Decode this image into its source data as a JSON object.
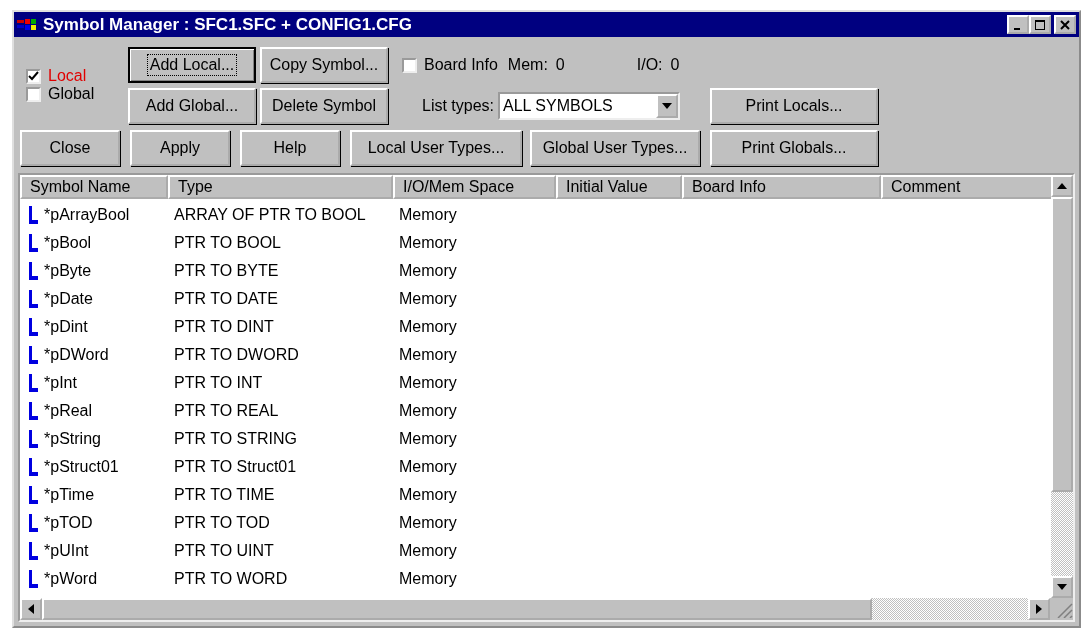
{
  "window": {
    "title": "Symbol Manager : SFC1.SFC + CONFIG1.CFG"
  },
  "scope_checkboxes": [
    {
      "label": "Local",
      "checked": true
    },
    {
      "label": "Global",
      "checked": false
    }
  ],
  "row1_buttons": [
    {
      "label": "Add Local...",
      "focused": true
    },
    {
      "label": "Copy Symbol...",
      "focused": false
    }
  ],
  "board_info": {
    "label": "Board Info",
    "checked": false
  },
  "mem": {
    "label": "Mem:",
    "value": "0"
  },
  "io": {
    "label": "I/O:",
    "value": "0"
  },
  "row2_buttons": [
    {
      "label": "Add Global...",
      "focused": false
    },
    {
      "label": "Delete Symbol",
      "focused": false
    }
  ],
  "list_types": {
    "label": "List types:",
    "value": "ALL SYMBOLS"
  },
  "print_locals": {
    "label": "Print Locals..."
  },
  "row3_buttons": [
    "Close",
    "Apply",
    "Help",
    "Local User Types...",
    "Global User Types...",
    "Print Globals..."
  ],
  "table": {
    "columns": [
      "Symbol Name",
      "Type",
      "I/O/Mem Space",
      "Initial Value",
      "Board Info",
      "Comment"
    ],
    "rows": [
      {
        "name": "*pArrayBool",
        "type": "ARRAY OF PTR TO BOOL",
        "space": "Memory"
      },
      {
        "name": "*pBool",
        "type": "PTR TO BOOL",
        "space": "Memory"
      },
      {
        "name": "*pByte",
        "type": "PTR TO BYTE",
        "space": "Memory"
      },
      {
        "name": "*pDate",
        "type": "PTR TO DATE",
        "space": "Memory"
      },
      {
        "name": "*pDint",
        "type": "PTR TO DINT",
        "space": "Memory"
      },
      {
        "name": "*pDWord",
        "type": "PTR TO DWORD",
        "space": "Memory"
      },
      {
        "name": "*pInt",
        "type": "PTR TO INT",
        "space": "Memory"
      },
      {
        "name": "*pReal",
        "type": "PTR TO REAL",
        "space": "Memory"
      },
      {
        "name": "*pString",
        "type": "PTR TO STRING",
        "space": "Memory"
      },
      {
        "name": "*pStruct01",
        "type": "PTR TO Struct01",
        "space": "Memory"
      },
      {
        "name": "*pTime",
        "type": "PTR TO TIME",
        "space": "Memory"
      },
      {
        "name": "*pTOD",
        "type": "PTR TO TOD",
        "space": "Memory"
      },
      {
        "name": "*pUInt",
        "type": "PTR TO UINT",
        "space": "Memory"
      },
      {
        "name": "*pWord",
        "type": "PTR TO WORD",
        "space": "Memory"
      }
    ]
  }
}
